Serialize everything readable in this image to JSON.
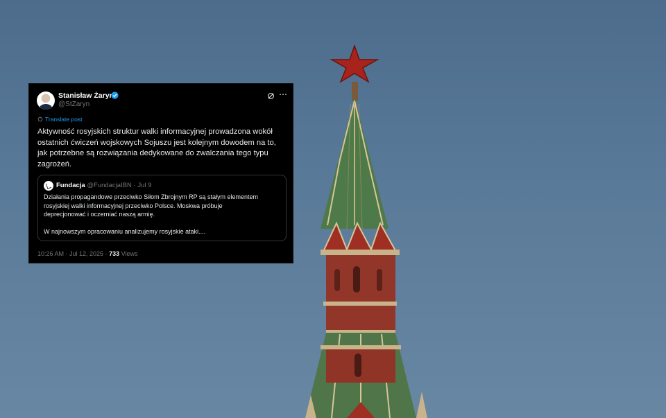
{
  "post": {
    "author_name": "Stanisław Żaryn",
    "handle": "@StZaryn",
    "translate_label": "Translate post",
    "text": "Aktywność rosyjskich struktur walki informacyjnej prowadzona wokół\nostatnich ćwiczeń wojskowych Sojuszu jest kolejnym dowodem na to,\njak potrzebne są  rozwiązania dedykowane do zwalczania tego typu\nzagrożeń.",
    "quote": {
      "name": "Fundacja",
      "handle": "@FundacjaIBN",
      "separator": "·",
      "date": "Jul 9",
      "text": "Działania propagandowe przeciwko Siłom Zbrojnym RP są stałym elementem\nrosyjskiej walki informacyjnej przeciwko Polsce. Moskwa próbuje\ndeprecjonować i oczerniać naszą armię.\n\nW najnowszym opracowaniu analizujemy rosyjskie ataki...."
    },
    "timestamp": "10:26 AM · Jul 12, 2025 · ",
    "views_count": "733",
    "views_label": " Views"
  },
  "colors": {
    "sky": "#5a7a99",
    "card_bg": "#000000",
    "link": "#1d9bf0",
    "muted": "#71767b",
    "star": "#b3201c",
    "tower_brick": "#9e3a2a"
  },
  "icons": {
    "verified": "verified-badge-icon",
    "grok": "grok-icon",
    "more": "more-icon",
    "translate": "translate-icon"
  }
}
